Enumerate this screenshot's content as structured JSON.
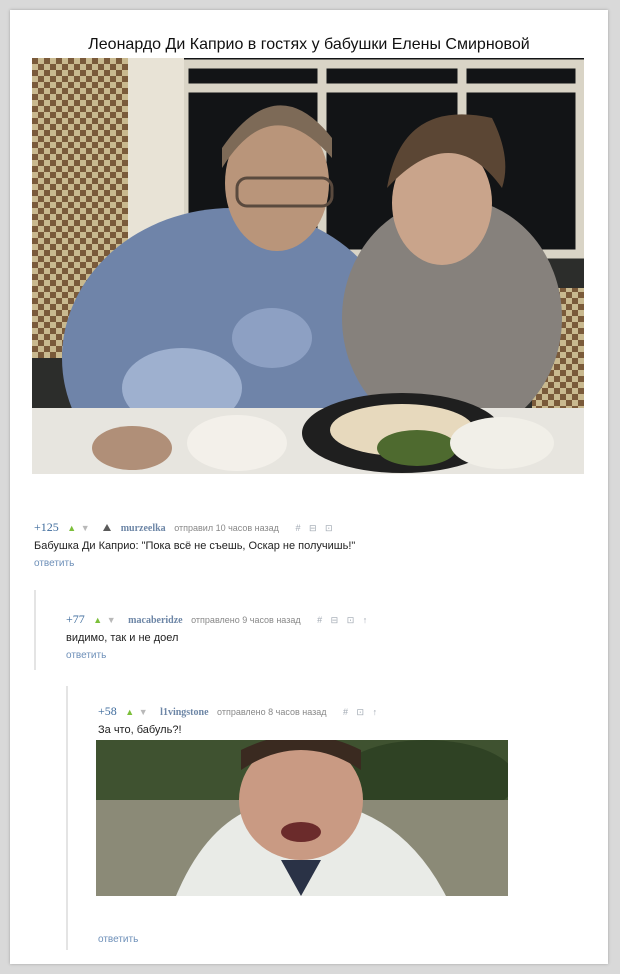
{
  "post": {
    "title": "Леонардо Ди Каприо в гостях у бабушки Елены Смирновой"
  },
  "comments": [
    {
      "rating": "+125",
      "author": "murzeelka",
      "time": "отправил 10 часов назад",
      "icons": [
        "hash-icon",
        "save-icon",
        "save-icon"
      ],
      "text": "Бабушка Ди Каприо: \"Пока всё не съешь, Оскар не получишь!\"",
      "reply_label": "ответить"
    },
    {
      "rating": "+77",
      "author": "macaberidze",
      "time": "отправлено 9 часов назад",
      "icons": [
        "hash-icon",
        "save-icon",
        "save-icon",
        "up-arrow-icon"
      ],
      "text": "видимо, так и не доел",
      "reply_label": "ответить"
    },
    {
      "rating": "+58",
      "author": "l1vingstone",
      "time": "отправлено 8 часов назад",
      "icons": [
        "hash-icon",
        "save-icon",
        "up-arrow-icon"
      ],
      "text": "За что, бабуль?!",
      "reply_label": "ответить"
    }
  ],
  "colors": {
    "rating": "#3e6b9c",
    "upvote": "#7cbf3a",
    "author": "#6d86a6",
    "reply_link": "#6d8fb8"
  }
}
